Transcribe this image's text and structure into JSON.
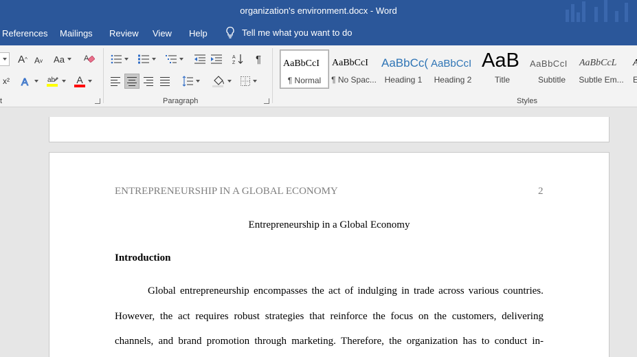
{
  "window": {
    "title": "organization's environment.docx  -  Word"
  },
  "tabs": {
    "references": "References",
    "mailings": "Mailings",
    "review": "Review",
    "view": "View",
    "help": "Help",
    "tell_me": "Tell me what you want to do"
  },
  "ribbon": {
    "font_group_label": "t",
    "paragraph_group_label": "Paragraph",
    "styles_group_label": "Styles",
    "grow_font": "A",
    "shrink_font": "A",
    "change_case": "Aa",
    "superscript": "x²",
    "font_color_letter": "A",
    "pilcrow": "¶",
    "highlight_color": "#ffff00",
    "font_color": "#ff0000"
  },
  "styles": [
    {
      "sample": "AaBbCcI",
      "name": "¶ Normal"
    },
    {
      "sample": "AaBbCcI",
      "name": "¶ No Spac..."
    },
    {
      "sample": "AaBbCc(",
      "name": "Heading 1"
    },
    {
      "sample": "AaBbCcI",
      "name": "Heading 2"
    },
    {
      "sample": "AaB",
      "name": "Title"
    },
    {
      "sample": "AaBbCcI",
      "name": "Subtitle"
    },
    {
      "sample": "AaBbCcL",
      "name": "Subtle Em..."
    },
    {
      "sample": "A",
      "name": "E"
    }
  ],
  "document": {
    "running_head": "ENTREPRENEURSHIP IN A GLOBAL ECONOMY",
    "page_number": "2",
    "title": "Entrepreneurship in a Global Economy",
    "heading": "Introduction",
    "paragraph_lines": [
      "Global entrepreneurship encompasses the act of indulging in trade across various countries.",
      "However, the act requires robust strategies that reinforce the focus on the customers, delivering",
      "channels, and brand promotion through marketing. Therefore, the organization has to conduct in-"
    ]
  }
}
